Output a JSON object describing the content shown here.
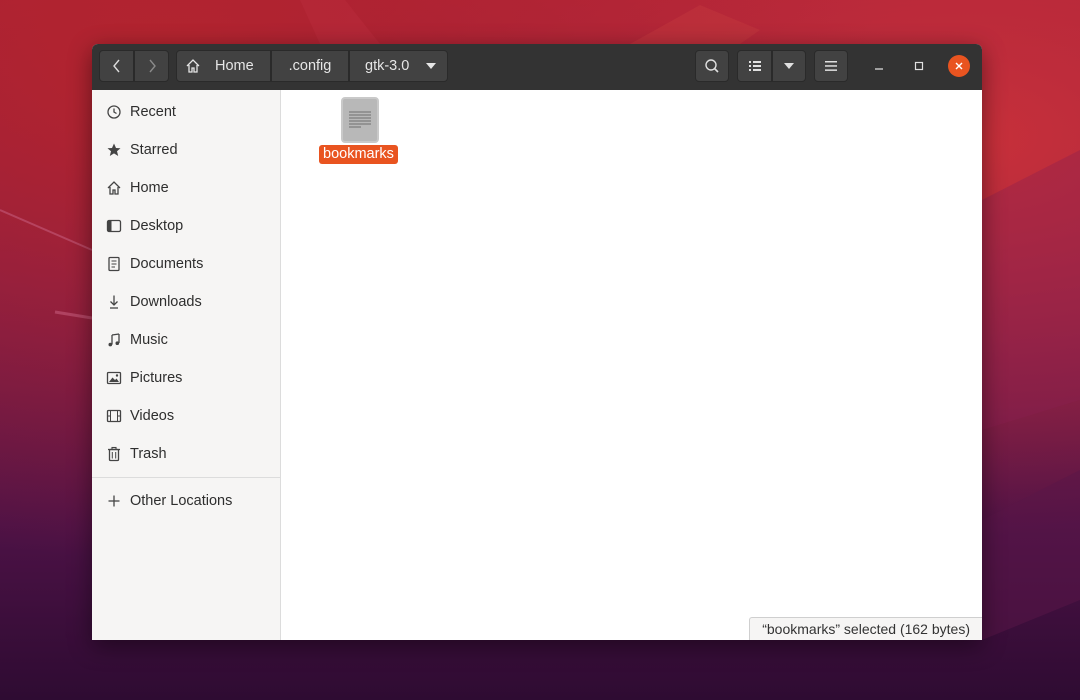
{
  "headerbar": {
    "nav_back_icon": "chevron-left-icon",
    "nav_forward_icon": "chevron-right-icon",
    "breadcrumbs": [
      {
        "label": "Home",
        "icon": "home-icon"
      },
      {
        "label": ".config"
      },
      {
        "label": "gtk-3.0",
        "icon": "caret-down-icon"
      }
    ],
    "search_icon": "search-icon",
    "view_icon": "list-view-icon",
    "view_dropdown_icon": "caret-down-icon",
    "menu_icon": "hamburger-menu-icon",
    "window_controls": [
      "minimize-icon",
      "maximize-icon",
      "close-icon"
    ]
  },
  "sidebar": {
    "items": [
      {
        "label": "Recent",
        "icon": "clock-icon"
      },
      {
        "label": "Starred",
        "icon": "star-icon"
      },
      {
        "label": "Home",
        "icon": "home-icon"
      },
      {
        "label": "Desktop",
        "icon": "desktop-icon"
      },
      {
        "label": "Documents",
        "icon": "document-icon"
      },
      {
        "label": "Downloads",
        "icon": "download-icon"
      },
      {
        "label": "Music",
        "icon": "music-icon"
      },
      {
        "label": "Pictures",
        "icon": "picture-icon"
      },
      {
        "label": "Videos",
        "icon": "video-icon"
      },
      {
        "label": "Trash",
        "icon": "trash-icon"
      }
    ],
    "other_locations": {
      "label": "Other Locations",
      "icon": "plus-icon"
    }
  },
  "files": [
    {
      "name": "bookmarks",
      "icon": "text-file-icon",
      "selected": true
    }
  ],
  "status": {
    "text": "“bookmarks” selected  (162 bytes)"
  },
  "colors": {
    "accent": "#e95420",
    "headerbar": "#333333",
    "sidebar": "#f6f5f4"
  }
}
